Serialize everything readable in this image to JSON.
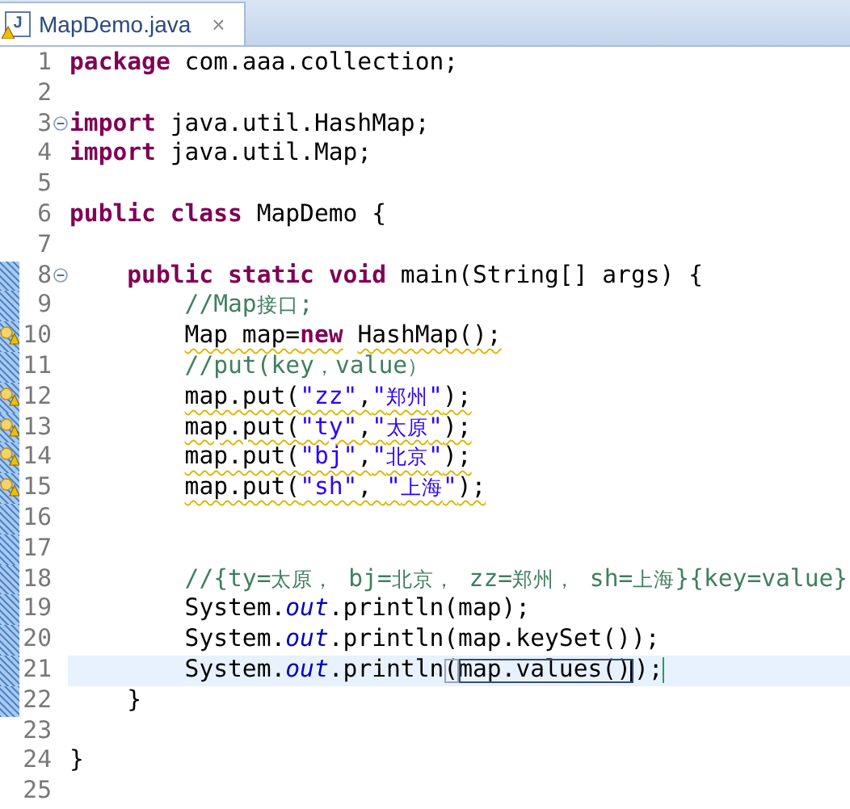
{
  "tab": {
    "icon_letter": "J",
    "title": "MapDemo.java",
    "close": "×"
  },
  "lines": [
    {
      "number": "1",
      "fold": false,
      "warning": false,
      "changed": false,
      "current": false,
      "tokens": [
        {
          "kind": "keyword",
          "text": "package"
        },
        {
          "kind": "plain",
          "text": " com.aaa.collection;"
        }
      ]
    },
    {
      "number": "2",
      "fold": false,
      "warning": false,
      "changed": false,
      "current": false
    },
    {
      "number": "3",
      "fold": true,
      "warning": false,
      "changed": false,
      "current": false,
      "tokens": [
        {
          "kind": "keyword",
          "text": "import"
        },
        {
          "kind": "plain",
          "text": " java.util.HashMap;"
        }
      ]
    },
    {
      "number": "4",
      "fold": false,
      "warning": false,
      "changed": false,
      "current": false,
      "tokens": [
        {
          "kind": "keyword",
          "text": "import"
        },
        {
          "kind": "plain",
          "text": " java.util.Map;"
        }
      ]
    },
    {
      "number": "5",
      "fold": false,
      "warning": false,
      "changed": false,
      "current": false
    },
    {
      "number": "6",
      "fold": false,
      "warning": false,
      "changed": false,
      "current": false,
      "tokens": [
        {
          "kind": "keyword",
          "text": "public class"
        },
        {
          "kind": "plain",
          "text": " MapDemo {"
        }
      ]
    },
    {
      "number": "7",
      "fold": false,
      "warning": false,
      "changed": false,
      "current": false
    },
    {
      "number": "8",
      "fold": true,
      "warning": false,
      "changed": true,
      "current": false,
      "tokens": [
        {
          "kind": "keyword",
          "text": "\tpublic static void"
        },
        {
          "kind": "plain",
          "text": " main(String[] args) {"
        }
      ]
    },
    {
      "number": "9",
      "fold": false,
      "warning": false,
      "changed": true,
      "current": false,
      "tokens": [
        {
          "kind": "comment",
          "text": "\t\t//Map接口;"
        }
      ]
    },
    {
      "number": "10",
      "fold": false,
      "warning": true,
      "changed": true,
      "current": false,
      "tokens": [
        {
          "kind": "warn",
          "text": "\t\tMap map="
        },
        {
          "kind": "warnkeyword",
          "text": "new"
        },
        {
          "kind": "warn",
          "text": " HashMap();"
        }
      ]
    },
    {
      "number": "11",
      "fold": false,
      "warning": false,
      "changed": true,
      "current": false,
      "tokens": [
        {
          "kind": "comment",
          "text": "\t\t//put(key，value）"
        }
      ]
    },
    {
      "number": "12",
      "fold": false,
      "warning": true,
      "changed": true,
      "current": false,
      "tokens": [
        {
          "kind": "warn",
          "text": "\t\tmap.put("
        },
        {
          "kind": "warnstring",
          "text": "\"zz\""
        },
        {
          "kind": "warn",
          "text": ","
        },
        {
          "kind": "warnstring",
          "text": "\"郑州\""
        },
        {
          "kind": "warn",
          "text": ");"
        }
      ]
    },
    {
      "number": "13",
      "fold": false,
      "warning": true,
      "changed": true,
      "current": false,
      "tokens": [
        {
          "kind": "warn",
          "text": "\t\tmap.put("
        },
        {
          "kind": "warnstring",
          "text": "\"ty\""
        },
        {
          "kind": "warn",
          "text": ","
        },
        {
          "kind": "warnstring",
          "text": "\"太原\""
        },
        {
          "kind": "warn",
          "text": ");"
        }
      ]
    },
    {
      "number": "14",
      "fold": false,
      "warning": true,
      "changed": true,
      "current": false,
      "tokens": [
        {
          "kind": "warn",
          "text": "\t\tmap.put("
        },
        {
          "kind": "warnstring",
          "text": "\"bj\""
        },
        {
          "kind": "warn",
          "text": ","
        },
        {
          "kind": "warnstring",
          "text": "\"北京\""
        },
        {
          "kind": "warn",
          "text": ");"
        }
      ]
    },
    {
      "number": "15",
      "fold": false,
      "warning": true,
      "changed": true,
      "current": false,
      "tokens": [
        {
          "kind": "warn",
          "text": "\t\tmap.put("
        },
        {
          "kind": "warnstring",
          "text": "\"sh\""
        },
        {
          "kind": "warn",
          "text": ", "
        },
        {
          "kind": "warnstring",
          "text": "\"上海\""
        },
        {
          "kind": "warn",
          "text": ");"
        }
      ]
    },
    {
      "number": "16",
      "fold": false,
      "warning": false,
      "changed": true,
      "current": false
    },
    {
      "number": "17",
      "fold": false,
      "warning": false,
      "changed": true,
      "current": false
    },
    {
      "number": "18",
      "fold": false,
      "warning": false,
      "changed": true,
      "current": false,
      "tokens": [
        {
          "kind": "comment",
          "text": "\t\t//{ty=太原， bj=北京， zz=郑州， sh=上海}{key=value}"
        }
      ]
    },
    {
      "number": "19",
      "fold": false,
      "warning": false,
      "changed": true,
      "current": false,
      "tokens": [
        {
          "kind": "plain",
          "text": "\t\tSystem."
        },
        {
          "kind": "field",
          "text": "out"
        },
        {
          "kind": "plain",
          "text": ".println(map);"
        }
      ]
    },
    {
      "number": "20",
      "fold": false,
      "warning": false,
      "changed": true,
      "current": false,
      "tokens": [
        {
          "kind": "plain",
          "text": "\t\tSystem."
        },
        {
          "kind": "field",
          "text": "out"
        },
        {
          "kind": "plain",
          "text": ".println(map.keySet());"
        }
      ]
    },
    {
      "number": "21",
      "fold": false,
      "warning": false,
      "changed": true,
      "current": true,
      "tokens": [
        {
          "kind": "plain",
          "text": "\t\tSystem."
        },
        {
          "kind": "field",
          "text": "out"
        },
        {
          "kind": "plain",
          "text": ".println"
        },
        {
          "kind": "match",
          "text": "("
        },
        {
          "kind": "occurrence",
          "text": "map.values()"
        },
        {
          "kind": "plain",
          "text": ");"
        }
      ]
    },
    {
      "number": "22",
      "fold": false,
      "warning": false,
      "changed": true,
      "current": false,
      "tokens": [
        {
          "kind": "plain",
          "text": "\t}"
        }
      ]
    },
    {
      "number": "23",
      "fold": false,
      "warning": false,
      "changed": false,
      "current": false
    },
    {
      "number": "24",
      "fold": false,
      "warning": false,
      "changed": false,
      "current": false,
      "tokens": [
        {
          "kind": "plain",
          "text": "}"
        }
      ]
    },
    {
      "number": "25",
      "fold": false,
      "warning": false,
      "changed": false,
      "current": false
    }
  ]
}
